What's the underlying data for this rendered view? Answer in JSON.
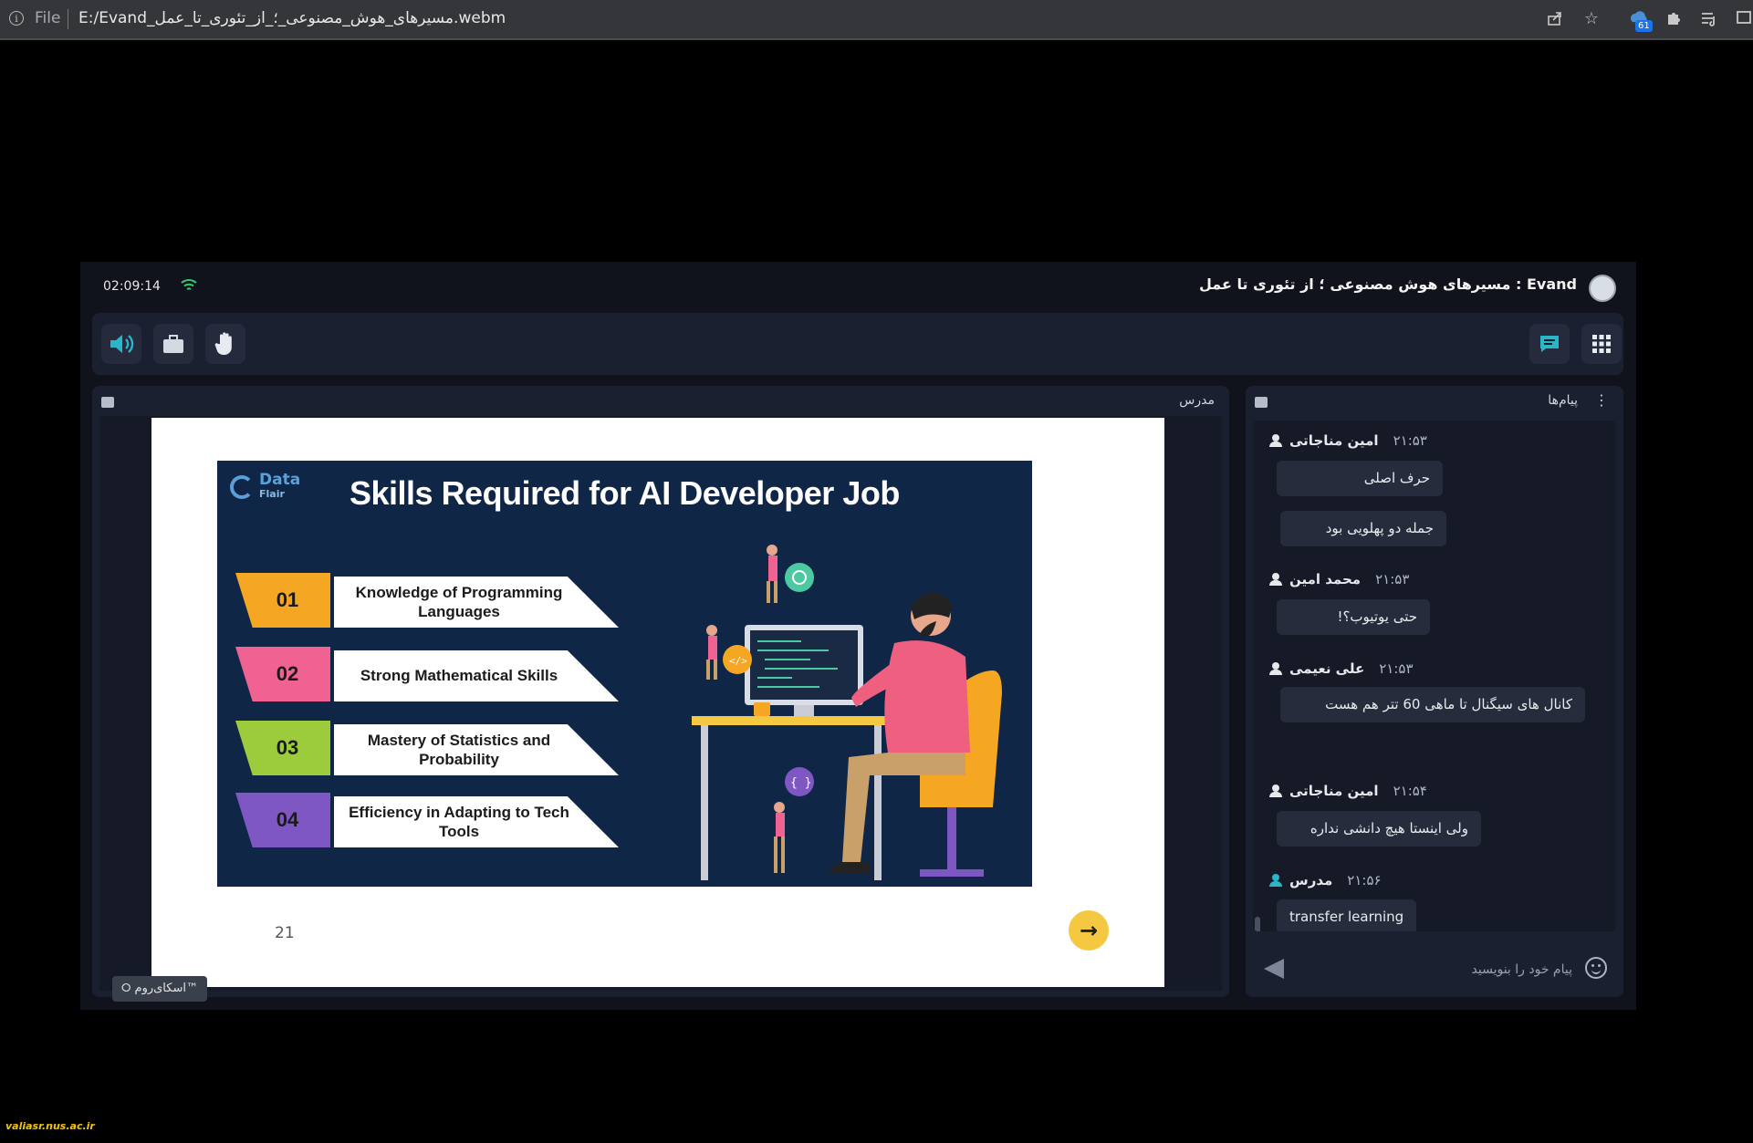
{
  "browser": {
    "file_label": "File",
    "url": "E:/Evand_مسیرهای_هوش_مصنوعی_؛_از_تئوری_تا_عمل.webm",
    "extension_badge": "61",
    "icons": [
      "info-icon",
      "share-icon",
      "star-icon",
      "extension-cloud-icon",
      "puzzle-icon",
      "playlist-icon",
      "window-icon"
    ]
  },
  "app": {
    "timer": "02:09:14",
    "title": "Evand : مسیرهای هوش مصنوعی ؛ از تئوری تا عمل",
    "toolbar_left": [
      "speaker-icon",
      "briefcase-icon",
      "raise-hand-icon"
    ],
    "toolbar_right": [
      "chat-icon",
      "apps-grid-icon"
    ],
    "accent": "#29b6c8"
  },
  "presenter": {
    "label": "مدرس",
    "skyroom": "™اسکای‌روم ⭘",
    "slide": {
      "logo_main": "Data",
      "logo_sub": "Flair",
      "title": "Skills Required for AI Developer Job",
      "skills": [
        {
          "num": "01",
          "text": "Knowledge of Programming Languages",
          "color": "#f5a623"
        },
        {
          "num": "02",
          "text": "Strong Mathematical Skills",
          "color": "#f06292"
        },
        {
          "num": "03",
          "text": "Mastery of Statistics and Probability",
          "color": "#9ccc3c"
        },
        {
          "num": "04",
          "text": "Efficiency in Adapting to Tech Tools",
          "color": "#7e57c2"
        }
      ],
      "page_number": "21",
      "next_arrow": "→"
    }
  },
  "chat": {
    "title": "پیام‌ها",
    "messages": [
      {
        "name": "امین مناجاتی",
        "time": "۲۱:۵۳",
        "bubbles": [
          "حرف اصلی",
          "جمله دو پهلویی بود"
        ]
      },
      {
        "name": "محمد امین",
        "time": "۲۱:۵۳",
        "bubbles": [
          "حتی یوتیوب؟!"
        ]
      },
      {
        "name": "علی نعیمی",
        "time": "۲۱:۵۳",
        "bubbles": [
          "کانال های سیگنال تا ماهی 60 تتر هم هست"
        ]
      },
      {
        "name": "امین مناجاتی",
        "time": "۲۱:۵۴",
        "bubbles": [
          "ولی اینستا هیچ دانشی نداره"
        ]
      },
      {
        "name": "مدرس",
        "time": "۲۱:۵۶",
        "bubbles": [
          "transfer learning"
        ]
      }
    ],
    "composer_placeholder": "پیام خود را بنویسید"
  },
  "watermark": "valiasr.nus.ac.ir"
}
